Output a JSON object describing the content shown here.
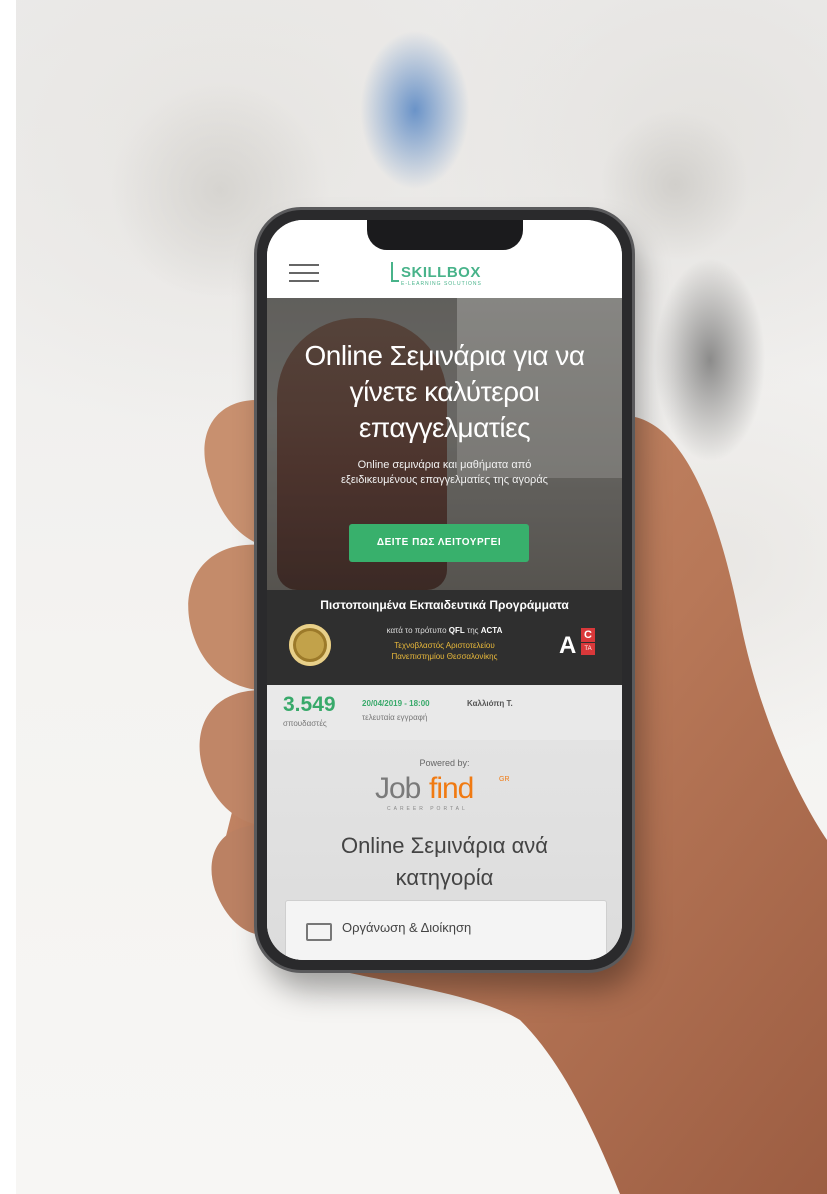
{
  "app": {
    "brand_name": "SKILLBOX",
    "brand_tagline": "E-LEARNING SOLUTIONS"
  },
  "hero": {
    "title_line1": "Online Σεμινάρια για να",
    "title_line2": "γίνετε καλύτεροι",
    "title_line3": "επαγγελματίες",
    "subtitle_line1": "Online σεμινάρια και μαθήματα από",
    "subtitle_line2": "εξειδικευμένους επαγγελματίες της αγοράς",
    "cta_label": "ΔΕΙΤΕ ΠΩΣ ΛΕΙΤΟΥΡΓΕΙ"
  },
  "certification": {
    "title": "Πιστοποιημένα Εκπαιδευτικά Προγράμματα",
    "line1_prefix": "κατά το πρότυπο",
    "line1_standard": "QFL",
    "line1_mid": "της",
    "line1_org": "ACTA",
    "line2": "Τεχνοβλαστός Αριστοτελείου",
    "line3": "Πανεπιστημίου Θεσσαλονίκης",
    "badge_a": "A",
    "badge_c": "C",
    "badge_ta": "TA"
  },
  "stats": {
    "count": "3.549",
    "count_label": "σπουδαστές",
    "last_date": "20/04/2019 - 18:00",
    "last_name": "Καλλιόπη Τ.",
    "last_label": "τελευταία εγγραφή"
  },
  "partner": {
    "powered_by": "Powered by:",
    "logo_job": "Job",
    "logo_find": "find",
    "logo_gr": "GR",
    "logo_sub": "CAREER PORTAL"
  },
  "categories": {
    "title_line1": "Online Σεμινάρια ανά",
    "title_line2": "κατηγορία",
    "items": [
      {
        "label": "Οργάνωση & Διοίκηση"
      }
    ]
  },
  "colors": {
    "accent_green": "#38b06c",
    "brand_teal": "#48b38a",
    "jobfind_orange": "#f07a12",
    "cert_bar": "#2f2f2f",
    "cert_gold": "#e9b93b"
  }
}
